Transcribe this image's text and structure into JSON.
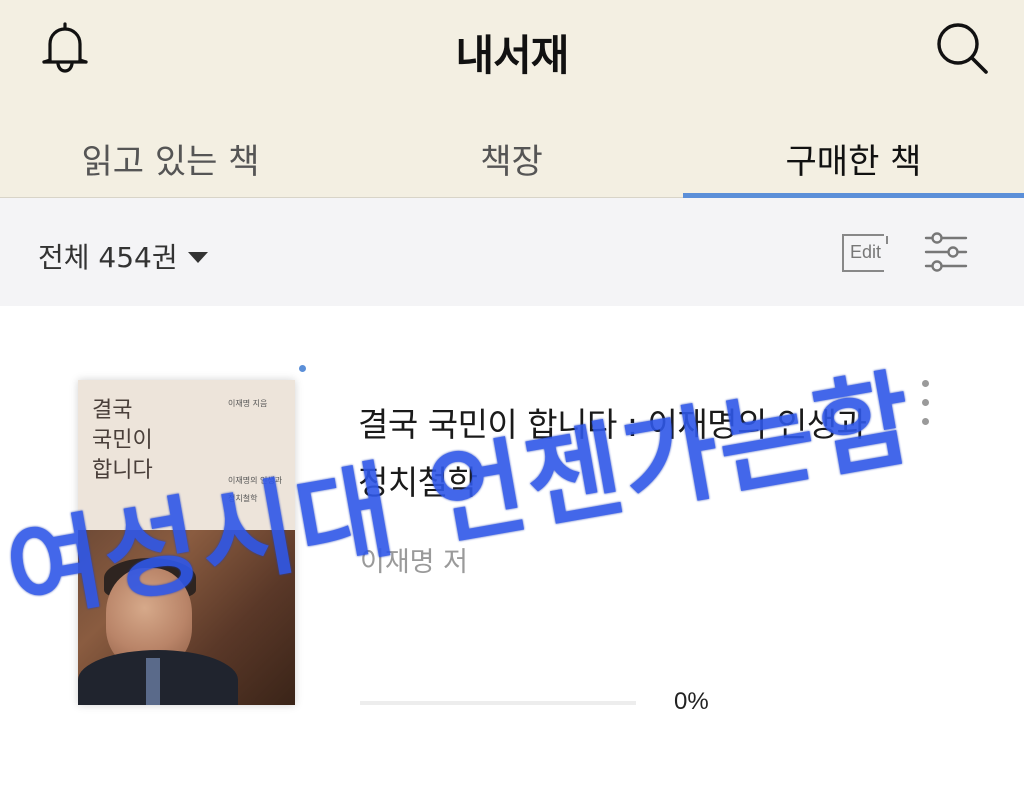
{
  "header": {
    "title": "내서재",
    "bell_icon": "bell-icon",
    "search_icon": "search-icon",
    "background": "#f3efe2"
  },
  "tabs": [
    {
      "label": "읽고 있는 책",
      "active": false
    },
    {
      "label": "책장",
      "active": false
    },
    {
      "label": "구매한 책",
      "active": true
    }
  ],
  "accent_color": "#5b8fd8",
  "filter": {
    "count_label": "전체 454권",
    "edit_label": "Edit",
    "filter_icon": "sliders-icon"
  },
  "books": [
    {
      "title": "결국 국민이 합니다 : 이재명의 인생과 정치철학",
      "author": "이재명 저",
      "progress": 0,
      "progress_label": "0%",
      "cover": {
        "title_line1": "결국",
        "title_line2": "국민이",
        "title_line3": "합니다",
        "author": "이재명 지음",
        "subtitle": "이재명의 인생과 정치철학"
      }
    }
  ],
  "overlay_text": "여성시대 언젠가는함",
  "overlay_color": "#2f57e8"
}
